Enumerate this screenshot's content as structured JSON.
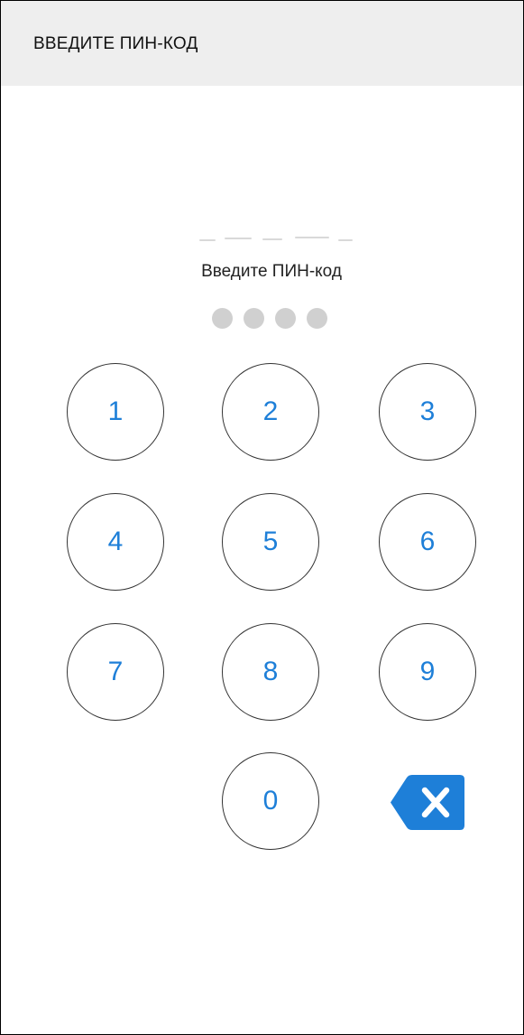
{
  "header": {
    "title": "ВВЕДИТЕ ПИН-КОД"
  },
  "pin": {
    "prompt": "Введите ПИН-код",
    "length": 4,
    "entered": 0
  },
  "keypad": {
    "keys": [
      "1",
      "2",
      "3",
      "4",
      "5",
      "6",
      "7",
      "8",
      "9",
      "0"
    ],
    "backspace_icon": "backspace-icon"
  },
  "colors": {
    "accent": "#1e7fd8",
    "header_bg": "#eeeeee",
    "dot_empty": "#d0d0d0"
  }
}
